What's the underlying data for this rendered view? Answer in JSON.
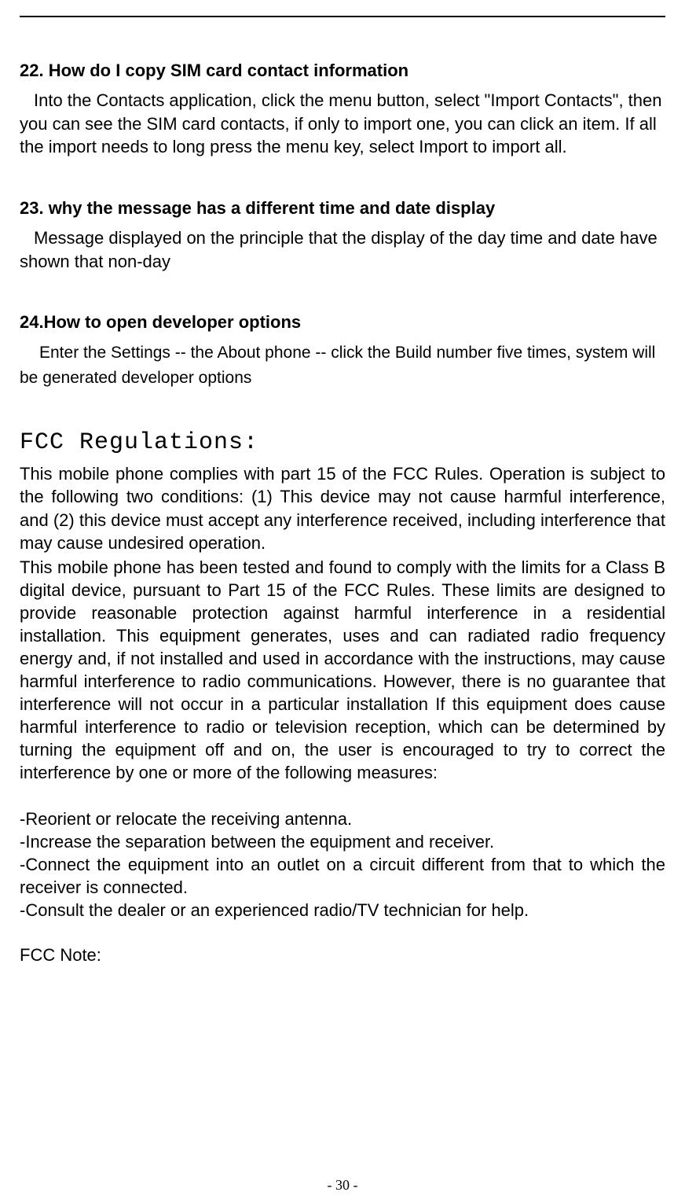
{
  "q22": {
    "heading": "22. How do I copy SIM card contact information",
    "body": "Into the Contacts application, click the menu button, select \"Import Contacts\", then you can see the SIM card contacts, if only to import one, you can click an item. If all the import needs to long press the menu key, select Import to import all."
  },
  "q23": {
    "heading": "23. why the message has a different time and date display",
    "body": "Message displayed on the principle that the display of the day time and date have shown that non-day"
  },
  "q24": {
    "heading": "24.How to open developer options",
    "body": "Enter the Settings -- the About phone -- click the Build number five times, system will be generated developer options"
  },
  "fcc": {
    "title": "FCC Regulations:",
    "p1": "This mobile phone complies with part 15 of the FCC Rules. Operation is subject to the following two conditions: (1) This device may not cause harmful interference, and (2) this device must accept any interference received, including interference that may cause undesired operation.",
    "p2": "This mobile phone has been tested and found to comply with the limits for a Class B digital device, pursuant to Part 15 of the FCC Rules. These limits are designed to provide reasonable protection against harmful interference in a residential installation. This equipment generates, uses and can radiated radio frequency energy and, if not installed and used in accordance with the instructions, may cause harmful interference to radio communications. However, there is no guarantee that interference will not occur in a particular installation If this equipment does cause harmful interference to radio or television reception, which can be determined by turning the equipment off and on, the user is encouraged to try to correct the interference by one or more of the following measures:",
    "m1": "-Reorient or relocate the receiving antenna.",
    "m2": "-Increase the separation between the equipment and receiver.",
    "m3": "-Connect the equipment into an outlet on a circuit different from that to which the receiver is connected.",
    "m4": "-Consult the dealer or an experienced radio/TV technician for help.",
    "note": "FCC Note:"
  },
  "page_number": "- 30 -"
}
